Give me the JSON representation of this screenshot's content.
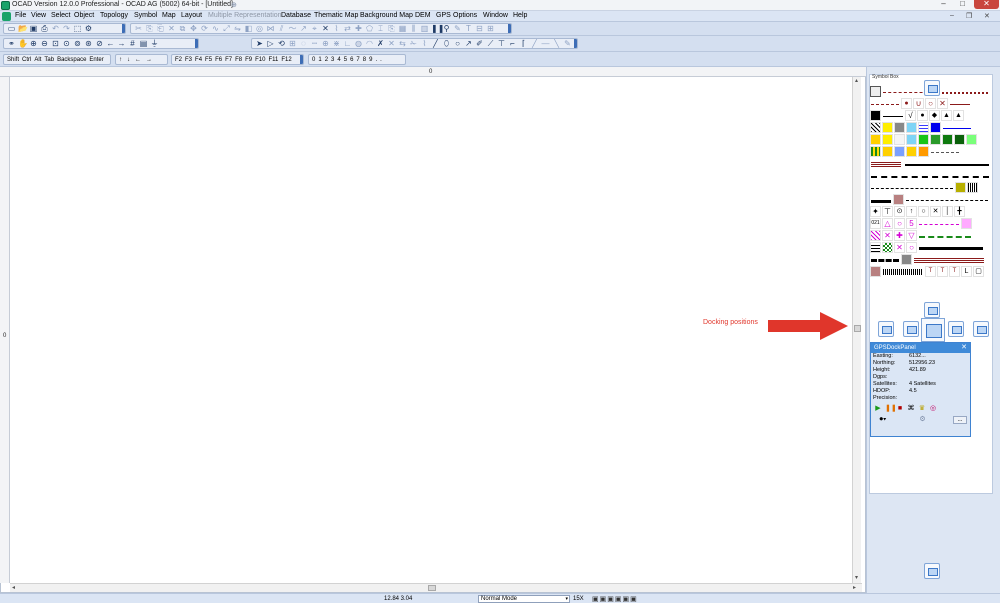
{
  "window": {
    "title": "OCAD Version 12.0.0  Professional - OCAD AG (5002) 64-bit - [Untitled]",
    "minimize": "–",
    "maximize": "□",
    "close": "✕"
  },
  "menu": {
    "items": [
      "File",
      "View",
      "Select",
      "Object",
      "Topology",
      "Symbol",
      "Map",
      "Layout",
      "Multiple Representation",
      "Database",
      "Thematic Map",
      "Background Map",
      "DEM",
      "GPS",
      "Options",
      "Window",
      "Help"
    ],
    "disabled": [
      "Multiple Representation"
    ]
  },
  "keys_toolbar": {
    "modifiers": [
      "Shift",
      "Ctrl",
      "Alt",
      "Tab",
      "Backspace",
      "Enter"
    ],
    "arrows": [
      "↑",
      "↓",
      "←",
      "→"
    ],
    "fkeys": [
      "F2",
      "F3",
      "F4",
      "F5",
      "F6",
      "F7",
      "F8",
      "F9",
      "F10",
      "F11",
      "F12"
    ],
    "digits": [
      "0",
      "1",
      "2",
      "3",
      "4",
      "5",
      "6",
      "7",
      "8",
      "9",
      ".",
      "."
    ]
  },
  "rulers": {
    "top_zero": "0",
    "left_zero": "0"
  },
  "annotation": {
    "docking_label": "Docking positions",
    "arrow_color": "#e0362b"
  },
  "symbol_box": {
    "title": "Symbol Box"
  },
  "gps_panel": {
    "title": "GPSDockPanel",
    "close": "✕",
    "fields": [
      {
        "label": "Easting:",
        "value": "6132..."
      },
      {
        "label": "Northing:",
        "value": "512956.23"
      },
      {
        "label": "Height:",
        "value": "421.89"
      },
      {
        "label": "Dgps:",
        "value": ""
      },
      {
        "label": "Satellites:",
        "value": "4 Satellites"
      },
      {
        "label": "HDOP:",
        "value": "4.5"
      },
      {
        "label": "Precision:",
        "value": ""
      }
    ],
    "ellipsis": "..."
  },
  "status": {
    "coords": "12.84  3.04",
    "mode": "Normal Mode",
    "zoom": "15X"
  },
  "colors": {
    "accent": "#3f8ad8",
    "menubar": "#dbe5f4",
    "canvas": "#ffffff"
  }
}
